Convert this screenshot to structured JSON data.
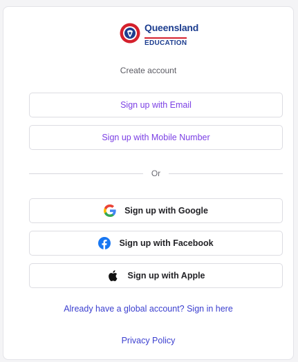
{
  "logo": {
    "name": "Queensland",
    "subtitle": "EDUCATION"
  },
  "header": {
    "create_account": "Create account"
  },
  "buttons": {
    "email": "Sign up with Email",
    "mobile": "Sign up with Mobile Number",
    "google": "Sign up with Google",
    "facebook": "Sign up with Facebook",
    "apple": "Sign up with Apple"
  },
  "divider": {
    "label": "Or"
  },
  "links": {
    "sign_in": "Already have a global account? Sign in here",
    "privacy": "Privacy Policy"
  },
  "icons": {
    "google": "google-icon",
    "facebook": "facebook-icon",
    "apple": "apple-icon"
  },
  "colors": {
    "accent_purple": "#7b3fe4",
    "link_blue": "#3b3fcf",
    "brand_navy": "#1c3d8f",
    "brand_red": "#d4202c",
    "facebook_blue": "#1877f2"
  }
}
